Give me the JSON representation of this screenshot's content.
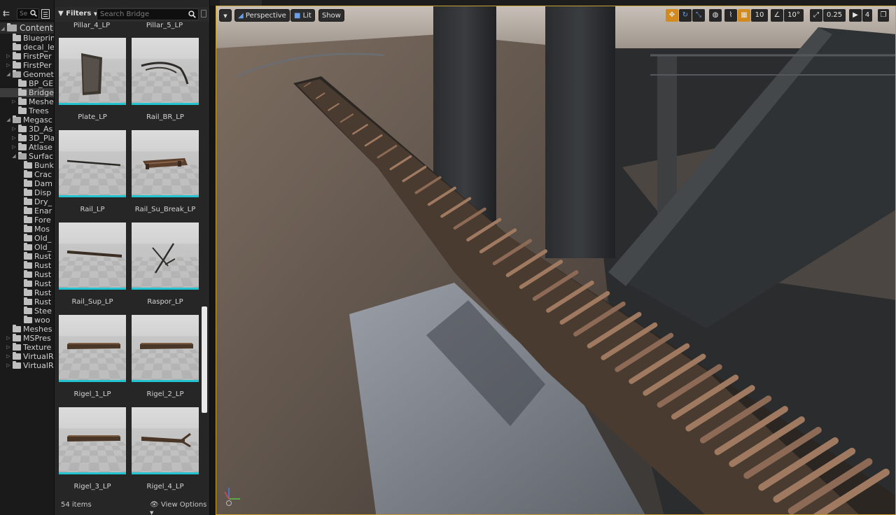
{
  "folder_tree": {
    "search_placeholder": "Se",
    "root": "Content",
    "items": [
      {
        "label": "Blueprin",
        "indent": 1,
        "arrow": ""
      },
      {
        "label": "decal_le",
        "indent": 1,
        "arrow": ""
      },
      {
        "label": "FirstPer",
        "indent": 1,
        "arrow": "closed"
      },
      {
        "label": "FirstPer",
        "indent": 1,
        "arrow": "closed"
      },
      {
        "label": "Geomet",
        "indent": 1,
        "arrow": "open"
      },
      {
        "label": "BP_GE",
        "indent": 2,
        "arrow": ""
      },
      {
        "label": "Bridge",
        "indent": 2,
        "arrow": "",
        "selected": true
      },
      {
        "label": "Meshe",
        "indent": 2,
        "arrow": "closed"
      },
      {
        "label": "Trees",
        "indent": 2,
        "arrow": ""
      },
      {
        "label": "Megasc",
        "indent": 1,
        "arrow": "open"
      },
      {
        "label": "3D_As",
        "indent": 2,
        "arrow": "closed"
      },
      {
        "label": "3D_Pla",
        "indent": 2,
        "arrow": "closed"
      },
      {
        "label": "Atlase",
        "indent": 2,
        "arrow": "closed"
      },
      {
        "label": "Surfac",
        "indent": 2,
        "arrow": "open"
      },
      {
        "label": "Bunk",
        "indent": 3,
        "arrow": ""
      },
      {
        "label": "Crac",
        "indent": 3,
        "arrow": ""
      },
      {
        "label": "Dam",
        "indent": 3,
        "arrow": ""
      },
      {
        "label": "Disp",
        "indent": 3,
        "arrow": ""
      },
      {
        "label": "Dry_",
        "indent": 3,
        "arrow": ""
      },
      {
        "label": "Enar",
        "indent": 3,
        "arrow": ""
      },
      {
        "label": "Fore",
        "indent": 3,
        "arrow": ""
      },
      {
        "label": "Mos",
        "indent": 3,
        "arrow": ""
      },
      {
        "label": "Old_",
        "indent": 3,
        "arrow": ""
      },
      {
        "label": "Old_",
        "indent": 3,
        "arrow": ""
      },
      {
        "label": "Rust",
        "indent": 3,
        "arrow": ""
      },
      {
        "label": "Rust",
        "indent": 3,
        "arrow": ""
      },
      {
        "label": "Rust",
        "indent": 3,
        "arrow": ""
      },
      {
        "label": "Rust",
        "indent": 3,
        "arrow": ""
      },
      {
        "label": "Rust",
        "indent": 3,
        "arrow": ""
      },
      {
        "label": "Rust",
        "indent": 3,
        "arrow": ""
      },
      {
        "label": "Stee",
        "indent": 3,
        "arrow": ""
      },
      {
        "label": "woo",
        "indent": 3,
        "arrow": ""
      },
      {
        "label": "Meshes",
        "indent": 1,
        "arrow": ""
      },
      {
        "label": "MSPres",
        "indent": 1,
        "arrow": "closed"
      },
      {
        "label": "Texture",
        "indent": 1,
        "arrow": "closed"
      },
      {
        "label": "VirtualR",
        "indent": 1,
        "arrow": "closed"
      },
      {
        "label": "VirtualR",
        "indent": 1,
        "arrow": "closed"
      }
    ]
  },
  "asset_browser": {
    "filters_label": "Filters",
    "search_placeholder": "Search Bridge",
    "partial_row": [
      "Pillar_4_LP",
      "Pillar_5_LP"
    ],
    "tiles": [
      {
        "label": "Plate_LP",
        "mesh": "plate"
      },
      {
        "label": "Rail_BR_LP",
        "mesh": "curve"
      },
      {
        "label": "Rail_LP",
        "mesh": "thin"
      },
      {
        "label": "Rail_Su_Break_LP",
        "mesh": "break"
      },
      {
        "label": "Rail_Sup_LP",
        "mesh": "thick"
      },
      {
        "label": "Raspor_LP",
        "mesh": "raspor"
      },
      {
        "label": "Rigel_1_LP",
        "mesh": "beam"
      },
      {
        "label": "Rigel_2_LP",
        "mesh": "beam"
      },
      {
        "label": "Rigel_3_LP",
        "mesh": "beam"
      },
      {
        "label": "Rigel_4_LP",
        "mesh": "fork"
      }
    ],
    "item_count": "54 items",
    "view_options_label": "View Options"
  },
  "viewport": {
    "view_mode": "Perspective",
    "lighting": "Lit",
    "show_label": "Show",
    "grid_snap": "10",
    "rotation_snap": "10°",
    "scale_snap": "0.25",
    "camera_speed": "4",
    "accent_color": "#d28a1c",
    "border_color": "#c8a232",
    "selection_color": "#22c2cf"
  }
}
